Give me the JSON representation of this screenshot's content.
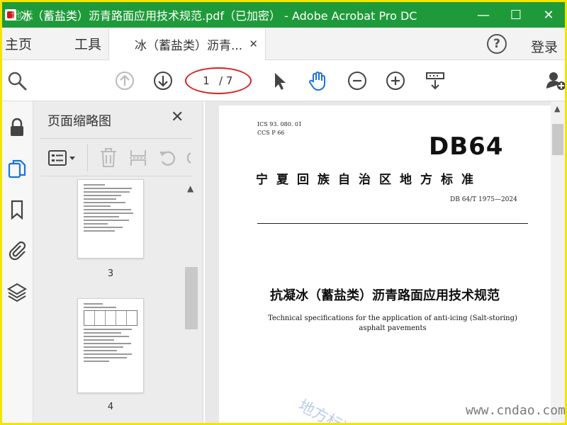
{
  "window": {
    "title": "冰（蓄盐类）沥青路面应用技术规范.pdf（已加密） - Adobe Acrobat Pro DC",
    "minimize": "—",
    "maximize": "☐",
    "close": "✕"
  },
  "tabs": {
    "home": "主页",
    "tools": "工具",
    "document": "冰（蓄盐类）沥青...",
    "document_close": "✕",
    "help": "?",
    "login": "登录"
  },
  "toolbar": {
    "current_page": "1",
    "total_pages": "/ 7"
  },
  "left_strip": {
    "icons": [
      "lock-icon",
      "pages-icon",
      "bookmark-icon",
      "attachment-icon",
      "layers-icon"
    ]
  },
  "thumbnails": {
    "title": "页面缩略图",
    "close": "✕",
    "pages": [
      {
        "number": "3"
      },
      {
        "number": "4"
      }
    ]
  },
  "document": {
    "ics": "ICS  93. 080. 01",
    "ccs": "CCS  P  66",
    "logo": "DB64",
    "org": "宁夏回族自治区地方标准",
    "standard_no": "DB 64/T  1975—2024",
    "title_cn": "抗凝冰（蓄盐类）沥青路面应用技术规范",
    "title_en": "Technical specifications for the application of anti-icing (Salt-storing) asphalt pavements"
  },
  "watermarks": {
    "url": "www.cndao.com",
    "cn": "地方标准",
    "corner": "地标"
  },
  "colors": {
    "titlebar": "#1f9a3a",
    "frame": "#f2e600",
    "accent_blue": "#1a73d9",
    "highlight_red": "#d62020"
  }
}
